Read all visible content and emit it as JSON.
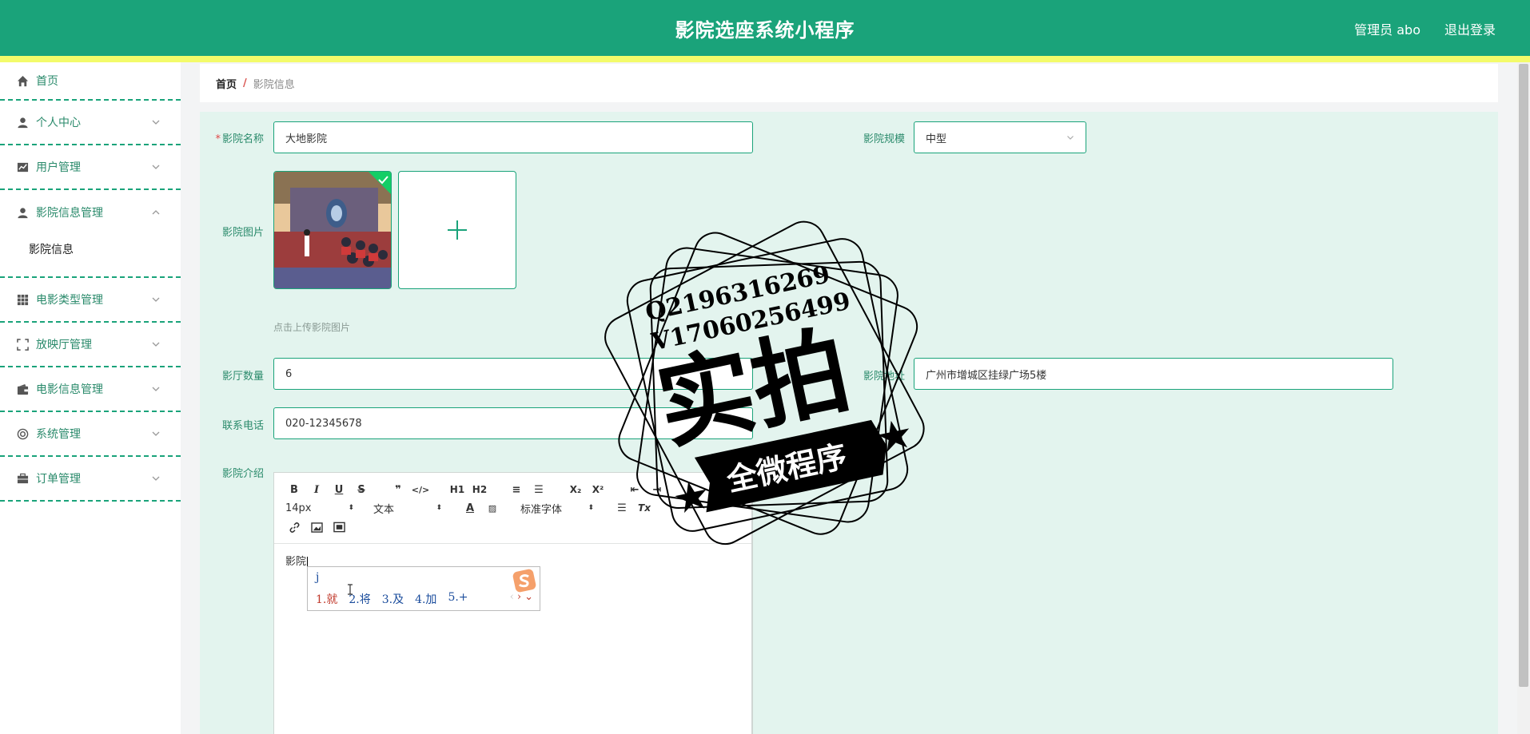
{
  "header": {
    "title": "影院选座系统小程序",
    "user": "管理员 abo",
    "logout": "退出登录"
  },
  "sidebar": {
    "items": [
      {
        "label": "首页",
        "icon": "home-icon"
      },
      {
        "label": "个人中心",
        "icon": "person-icon"
      },
      {
        "label": "用户管理",
        "icon": "chart-icon"
      },
      {
        "label": "影院信息管理",
        "icon": "person-icon",
        "open": true,
        "children": [
          "影院信息"
        ]
      },
      {
        "label": "电影类型管理",
        "icon": "grid-icon"
      },
      {
        "label": "放映厅管理",
        "icon": "frame-icon"
      },
      {
        "label": "电影信息管理",
        "icon": "wallet-icon"
      },
      {
        "label": "系统管理",
        "icon": "settings-icon"
      },
      {
        "label": "订单管理",
        "icon": "briefcase-icon"
      }
    ]
  },
  "breadcrumb": {
    "home": "首页",
    "sep": "/",
    "current": "影院信息"
  },
  "form": {
    "name_label": "影院名称",
    "name_value": "大地影院",
    "scale_label": "影院规模",
    "scale_value": "中型",
    "image_label": "影院图片",
    "upload_hint": "点击上传影院图片",
    "hall_count_label": "影厅数量",
    "hall_count_value": "6",
    "address_label": "影院地址",
    "address_value": "广州市增城区挂绿广场5楼",
    "phone_label": "联系电话",
    "phone_value": "020-12345678",
    "intro_label": "影院介绍"
  },
  "editor": {
    "font_size": "14px",
    "block_type": "文本",
    "font_family": "标准字体",
    "content": "影院"
  },
  "ime": {
    "composition": "j",
    "candidates": [
      "1.就",
      "2.将",
      "3.及",
      "4.加",
      "5.+"
    ]
  },
  "watermark": {
    "line1": "Q2196316269",
    "line2": "V17060256499",
    "main": "实拍",
    "banner": "全微程序"
  },
  "colors": {
    "primary": "#1aa37a",
    "stripe": "#f3fb6a",
    "content_bg": "#e3f4ee"
  }
}
